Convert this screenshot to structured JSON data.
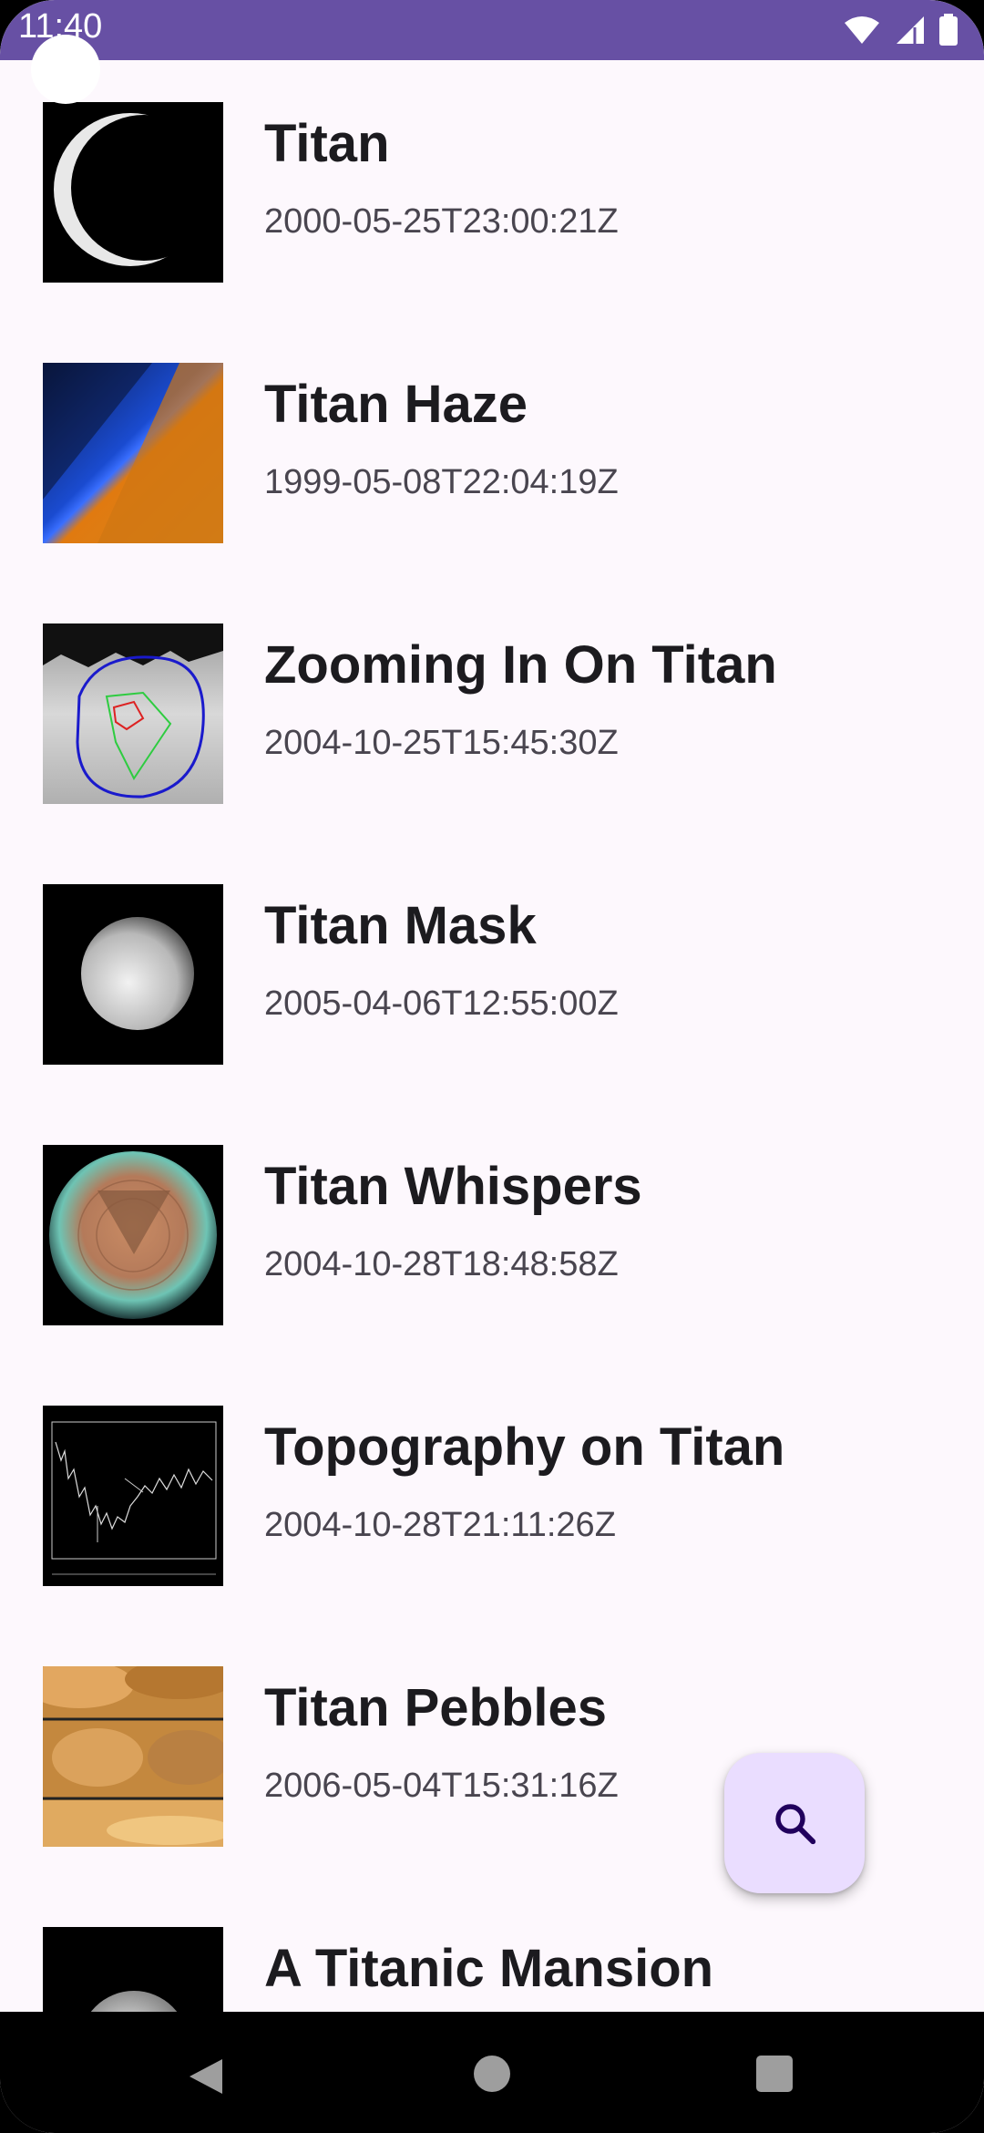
{
  "status_bar": {
    "time": "11:40",
    "icons": [
      "wifi-icon",
      "signal-icon",
      "battery-icon"
    ],
    "color": "#6750a4"
  },
  "items": [
    {
      "title": "Titan",
      "date": "2000-05-25T23:00:21Z",
      "thumb": "titan-crescent"
    },
    {
      "title": "Titan Haze",
      "date": "1999-05-08T22:04:19Z",
      "thumb": "titan-haze"
    },
    {
      "title": "Zooming In On Titan",
      "date": "2004-10-25T15:45:30Z",
      "thumb": "titan-zoom-map"
    },
    {
      "title": "Titan Mask",
      "date": "2005-04-06T12:55:00Z",
      "thumb": "titan-mask"
    },
    {
      "title": "Titan Whispers",
      "date": "2004-10-28T18:48:58Z",
      "thumb": "titan-whispers"
    },
    {
      "title": "Topography on Titan",
      "date": "2004-10-28T21:11:26Z",
      "thumb": "titan-topography-plot"
    },
    {
      "title": "Titan Pebbles",
      "date": "2006-05-04T15:31:16Z",
      "thumb": "titan-pebbles"
    },
    {
      "title": "A Titanic Mansion",
      "date": "",
      "thumb": "titanic-mansion"
    }
  ],
  "fab": {
    "icon": "search-icon",
    "bg": "#eaddff",
    "fg": "#21005d"
  },
  "nav_bar": {
    "buttons": [
      "back-icon",
      "home-icon",
      "recents-icon"
    ]
  }
}
